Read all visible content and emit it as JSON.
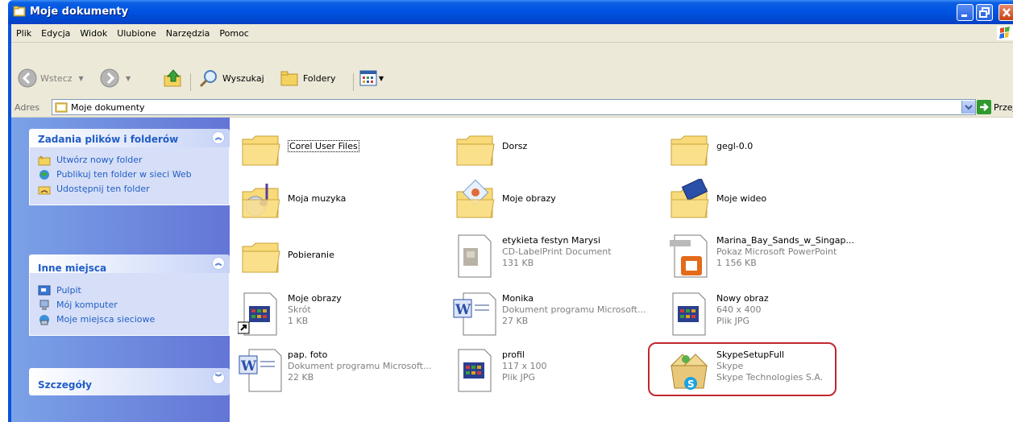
{
  "window": {
    "title": "Moje dokumenty"
  },
  "menu": [
    "Plik",
    "Edycja",
    "Widok",
    "Ulubione",
    "Narzędzia",
    "Pomoc"
  ],
  "toolbar": {
    "back": "Wstecz",
    "search": "Wyszukaj",
    "folders": "Foldery"
  },
  "address": {
    "label": "Adres",
    "value": "Moje dokumenty",
    "go": "Przejdź"
  },
  "panels": {
    "tasks": {
      "title": "Zadania plików i folderów",
      "items": [
        "Utwórz nowy folder",
        "Publikuj ten folder w sieci Web",
        "Udostępnij ten folder"
      ]
    },
    "places": {
      "title": "Inne miejsca",
      "items": [
        "Pulpit",
        "Mój komputer",
        "Moje miejsca sieciowe"
      ]
    },
    "details": {
      "title": "Szczegóły"
    }
  },
  "files": [
    {
      "name": "Corel User Files",
      "l2": "",
      "l3": "",
      "icon": "folder-icon"
    },
    {
      "name": "Dorsz",
      "l2": "",
      "l3": "",
      "icon": "folder-icon"
    },
    {
      "name": "gegl-0.0",
      "l2": "",
      "l3": "",
      "icon": "folder-icon"
    },
    {
      "name": "Moja muzyka",
      "l2": "",
      "l3": "",
      "icon": "music-folder-icon"
    },
    {
      "name": "Moje obrazy",
      "l2": "",
      "l3": "",
      "icon": "pictures-folder-icon"
    },
    {
      "name": "Moje wideo",
      "l2": "",
      "l3": "",
      "icon": "video-folder-icon"
    },
    {
      "name": "Pobieranie",
      "l2": "",
      "l3": "",
      "icon": "folder-icon"
    },
    {
      "name": "etykieta festyn Marysi",
      "l2": "CD-LabelPrint Document",
      "l3": "131 KB",
      "icon": "labelprint-document-icon"
    },
    {
      "name": "Marina_Bay_Sands_w_Singap...",
      "l2": "Pokaz Microsoft PowerPoint",
      "l3": "1 156 KB",
      "icon": "powerpoint-icon"
    },
    {
      "name": "Moje obrazy",
      "l2": "Skrót",
      "l3": "1 KB",
      "icon": "shortcut-image-icon"
    },
    {
      "name": "Monika",
      "l2": "Dokument programu Microsoft...",
      "l3": "27 KB",
      "icon": "word-document-icon"
    },
    {
      "name": "Nowy obraz",
      "l2": "640 x 400",
      "l3": "Plik JPG",
      "icon": "jpg-image-icon"
    },
    {
      "name": "pap. foto",
      "l2": "Dokument programu Microsoft...",
      "l3": "22 KB",
      "icon": "word-document-icon"
    },
    {
      "name": "profil",
      "l2": "117 x 100",
      "l3": "Plik JPG",
      "icon": "jpg-image-icon"
    },
    {
      "name": "SkypeSetupFull",
      "l2": "Skype",
      "l3": "Skype Technologies S.A.",
      "icon": "skype-installer-icon"
    }
  ]
}
